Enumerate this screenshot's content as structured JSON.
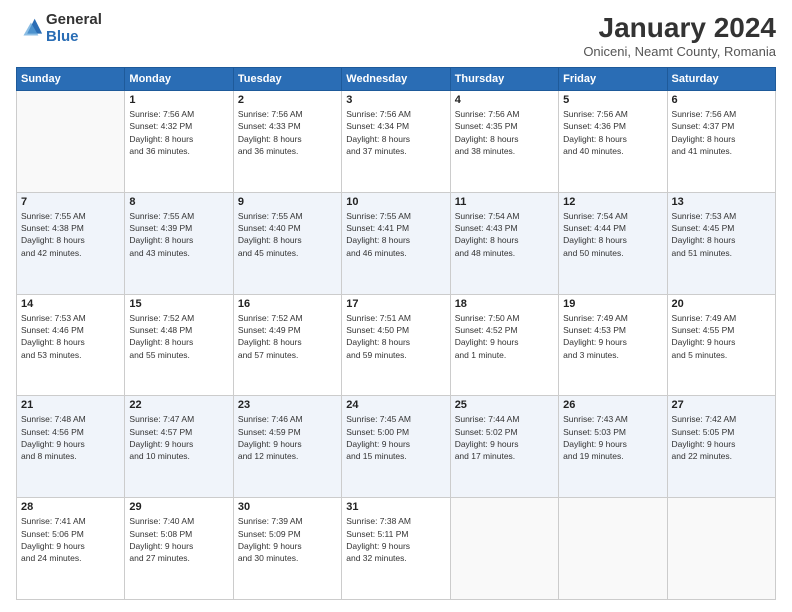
{
  "logo": {
    "general": "General",
    "blue": "Blue"
  },
  "title": {
    "month": "January 2024",
    "location": "Oniceni, Neamt County, Romania"
  },
  "weekdays": [
    "Sunday",
    "Monday",
    "Tuesday",
    "Wednesday",
    "Thursday",
    "Friday",
    "Saturday"
  ],
  "weeks": [
    [
      {
        "day": "",
        "info": ""
      },
      {
        "day": "1",
        "info": "Sunrise: 7:56 AM\nSunset: 4:32 PM\nDaylight: 8 hours\nand 36 minutes."
      },
      {
        "day": "2",
        "info": "Sunrise: 7:56 AM\nSunset: 4:33 PM\nDaylight: 8 hours\nand 36 minutes."
      },
      {
        "day": "3",
        "info": "Sunrise: 7:56 AM\nSunset: 4:34 PM\nDaylight: 8 hours\nand 37 minutes."
      },
      {
        "day": "4",
        "info": "Sunrise: 7:56 AM\nSunset: 4:35 PM\nDaylight: 8 hours\nand 38 minutes."
      },
      {
        "day": "5",
        "info": "Sunrise: 7:56 AM\nSunset: 4:36 PM\nDaylight: 8 hours\nand 40 minutes."
      },
      {
        "day": "6",
        "info": "Sunrise: 7:56 AM\nSunset: 4:37 PM\nDaylight: 8 hours\nand 41 minutes."
      }
    ],
    [
      {
        "day": "7",
        "info": "Sunrise: 7:55 AM\nSunset: 4:38 PM\nDaylight: 8 hours\nand 42 minutes."
      },
      {
        "day": "8",
        "info": "Sunrise: 7:55 AM\nSunset: 4:39 PM\nDaylight: 8 hours\nand 43 minutes."
      },
      {
        "day": "9",
        "info": "Sunrise: 7:55 AM\nSunset: 4:40 PM\nDaylight: 8 hours\nand 45 minutes."
      },
      {
        "day": "10",
        "info": "Sunrise: 7:55 AM\nSunset: 4:41 PM\nDaylight: 8 hours\nand 46 minutes."
      },
      {
        "day": "11",
        "info": "Sunrise: 7:54 AM\nSunset: 4:43 PM\nDaylight: 8 hours\nand 48 minutes."
      },
      {
        "day": "12",
        "info": "Sunrise: 7:54 AM\nSunset: 4:44 PM\nDaylight: 8 hours\nand 50 minutes."
      },
      {
        "day": "13",
        "info": "Sunrise: 7:53 AM\nSunset: 4:45 PM\nDaylight: 8 hours\nand 51 minutes."
      }
    ],
    [
      {
        "day": "14",
        "info": "Sunrise: 7:53 AM\nSunset: 4:46 PM\nDaylight: 8 hours\nand 53 minutes."
      },
      {
        "day": "15",
        "info": "Sunrise: 7:52 AM\nSunset: 4:48 PM\nDaylight: 8 hours\nand 55 minutes."
      },
      {
        "day": "16",
        "info": "Sunrise: 7:52 AM\nSunset: 4:49 PM\nDaylight: 8 hours\nand 57 minutes."
      },
      {
        "day": "17",
        "info": "Sunrise: 7:51 AM\nSunset: 4:50 PM\nDaylight: 8 hours\nand 59 minutes."
      },
      {
        "day": "18",
        "info": "Sunrise: 7:50 AM\nSunset: 4:52 PM\nDaylight: 9 hours\nand 1 minute."
      },
      {
        "day": "19",
        "info": "Sunrise: 7:49 AM\nSunset: 4:53 PM\nDaylight: 9 hours\nand 3 minutes."
      },
      {
        "day": "20",
        "info": "Sunrise: 7:49 AM\nSunset: 4:55 PM\nDaylight: 9 hours\nand 5 minutes."
      }
    ],
    [
      {
        "day": "21",
        "info": "Sunrise: 7:48 AM\nSunset: 4:56 PM\nDaylight: 9 hours\nand 8 minutes."
      },
      {
        "day": "22",
        "info": "Sunrise: 7:47 AM\nSunset: 4:57 PM\nDaylight: 9 hours\nand 10 minutes."
      },
      {
        "day": "23",
        "info": "Sunrise: 7:46 AM\nSunset: 4:59 PM\nDaylight: 9 hours\nand 12 minutes."
      },
      {
        "day": "24",
        "info": "Sunrise: 7:45 AM\nSunset: 5:00 PM\nDaylight: 9 hours\nand 15 minutes."
      },
      {
        "day": "25",
        "info": "Sunrise: 7:44 AM\nSunset: 5:02 PM\nDaylight: 9 hours\nand 17 minutes."
      },
      {
        "day": "26",
        "info": "Sunrise: 7:43 AM\nSunset: 5:03 PM\nDaylight: 9 hours\nand 19 minutes."
      },
      {
        "day": "27",
        "info": "Sunrise: 7:42 AM\nSunset: 5:05 PM\nDaylight: 9 hours\nand 22 minutes."
      }
    ],
    [
      {
        "day": "28",
        "info": "Sunrise: 7:41 AM\nSunset: 5:06 PM\nDaylight: 9 hours\nand 24 minutes."
      },
      {
        "day": "29",
        "info": "Sunrise: 7:40 AM\nSunset: 5:08 PM\nDaylight: 9 hours\nand 27 minutes."
      },
      {
        "day": "30",
        "info": "Sunrise: 7:39 AM\nSunset: 5:09 PM\nDaylight: 9 hours\nand 30 minutes."
      },
      {
        "day": "31",
        "info": "Sunrise: 7:38 AM\nSunset: 5:11 PM\nDaylight: 9 hours\nand 32 minutes."
      },
      {
        "day": "",
        "info": ""
      },
      {
        "day": "",
        "info": ""
      },
      {
        "day": "",
        "info": ""
      }
    ]
  ]
}
